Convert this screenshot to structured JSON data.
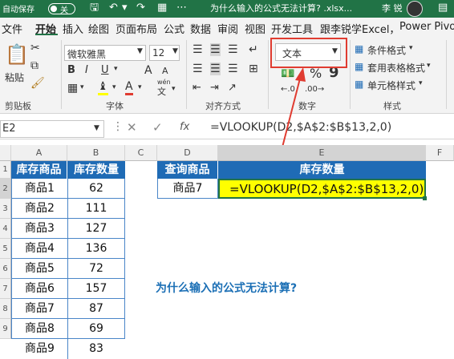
{
  "titlebar": {
    "autosave_label": "自动保存",
    "autosave_state": "关",
    "document_title": "为什么输入的公式无法计算? .xlsx...",
    "user_name": "李 锐"
  },
  "tabs": [
    {
      "label": "文件"
    },
    {
      "label": "开始"
    },
    {
      "label": "插入"
    },
    {
      "label": "绘图"
    },
    {
      "label": "页面布局"
    },
    {
      "label": "公式"
    },
    {
      "label": "数据"
    },
    {
      "label": "审阅"
    },
    {
      "label": "视图"
    },
    {
      "label": "开发工具"
    },
    {
      "label": "跟李锐学Excel，"
    },
    {
      "label": "Power Pivot"
    }
  ],
  "ribbon": {
    "paste_label": "粘贴",
    "clipboard_label": "剪贴板",
    "font_name": "微软雅黑",
    "font_size": "12",
    "font_group_label": "字体",
    "align_group_label": "对齐方式",
    "number_format": "文本",
    "number_group_label": "数字",
    "percent_symbol": "%",
    "comma_symbol": "9",
    "cond_format": "条件格式",
    "table_format": "套用表格格式",
    "cell_style": "单元格样式",
    "style_group_label": "样式",
    "bold": "B",
    "italic": "I",
    "underline": "U",
    "font_color_letter": "A",
    "grow_font": "A",
    "shrink_font": "A",
    "wen_label": "wén",
    "wen_char": "文"
  },
  "formula_bar": {
    "cell_ref": "E2",
    "fx": "fx",
    "formula": "=VLOOKUP(D2,$A$2:$B$13,2,0)"
  },
  "columns": [
    "A",
    "B",
    "C",
    "D",
    "E",
    "F"
  ],
  "rows": [
    "1",
    "2",
    "3",
    "4",
    "5",
    "6",
    "7",
    "8",
    "9"
  ],
  "table": {
    "headers": [
      "库存商品",
      "库存数量"
    ],
    "rows": [
      [
        "商品1",
        "62"
      ],
      [
        "商品2",
        "111"
      ],
      [
        "商品3",
        "127"
      ],
      [
        "商品4",
        "136"
      ],
      [
        "商品5",
        "72"
      ],
      [
        "商品6",
        "157"
      ],
      [
        "商品7",
        "87"
      ],
      [
        "商品8",
        "69"
      ],
      [
        "商品9",
        "83"
      ]
    ]
  },
  "lookup": {
    "header_query": "查询商品",
    "header_stock": "库存数量",
    "query_value": "商品7",
    "result_text": "=VLOOKUP(D2,$A$2:$B$13,2,0)"
  },
  "question": "为什么输入的公式无法计算?",
  "colors": {
    "excel_green": "#217346",
    "header_blue": "#1f6bb5",
    "highlight_yellow": "#ffff00",
    "annotation_red": "#e03c31",
    "question_blue": "#1b6fb5"
  }
}
